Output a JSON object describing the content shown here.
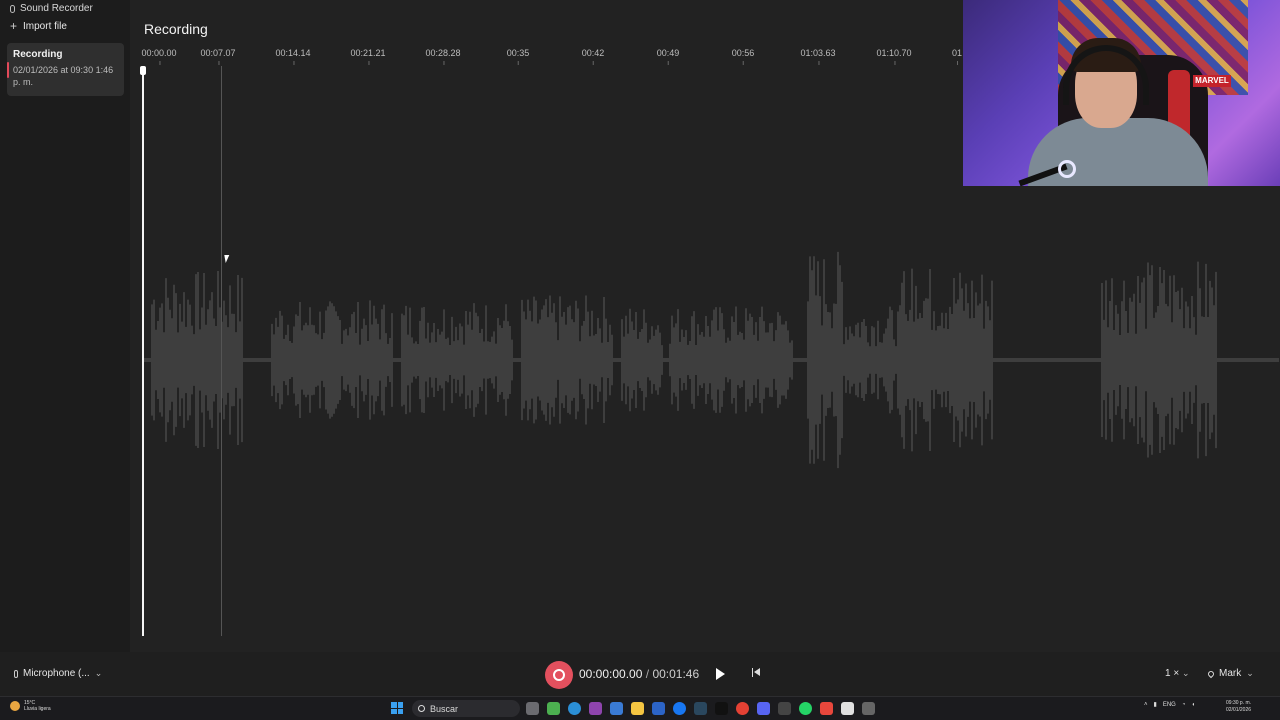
{
  "app": {
    "title": "Sound Recorder",
    "import_label": "Import file"
  },
  "recordings": [
    {
      "name": "Recording",
      "date": "02/01/2026 at 09:30 1:46 p. m."
    }
  ],
  "main": {
    "title": "Recording",
    "ruler_ticks": [
      "00:00.00",
      "00:07.07",
      "00:14.14",
      "00:21.21",
      "00:28.28",
      "00:35",
      "00:42",
      "00:49",
      "00:56",
      "01:03.63",
      "01:10.70",
      "01"
    ]
  },
  "player": {
    "current_time": "00:00:00.00",
    "separator": "/",
    "total_time": "00:01:46",
    "microphone_label": "Microphone (...",
    "speed_label": "1 ×",
    "mark_label": "Mark"
  },
  "webcam": {
    "logo_text": "MARVEL"
  },
  "taskbar": {
    "weather_temp": "15°C",
    "weather_desc": "Lluvia ligera",
    "search_placeholder": "Buscar",
    "language": "ENG",
    "time": "09:30 p. m.",
    "date": "02/01/2026"
  },
  "colors": {
    "accent": "#e3505e",
    "background": "#202020",
    "waveform": "#5a5a5a"
  }
}
